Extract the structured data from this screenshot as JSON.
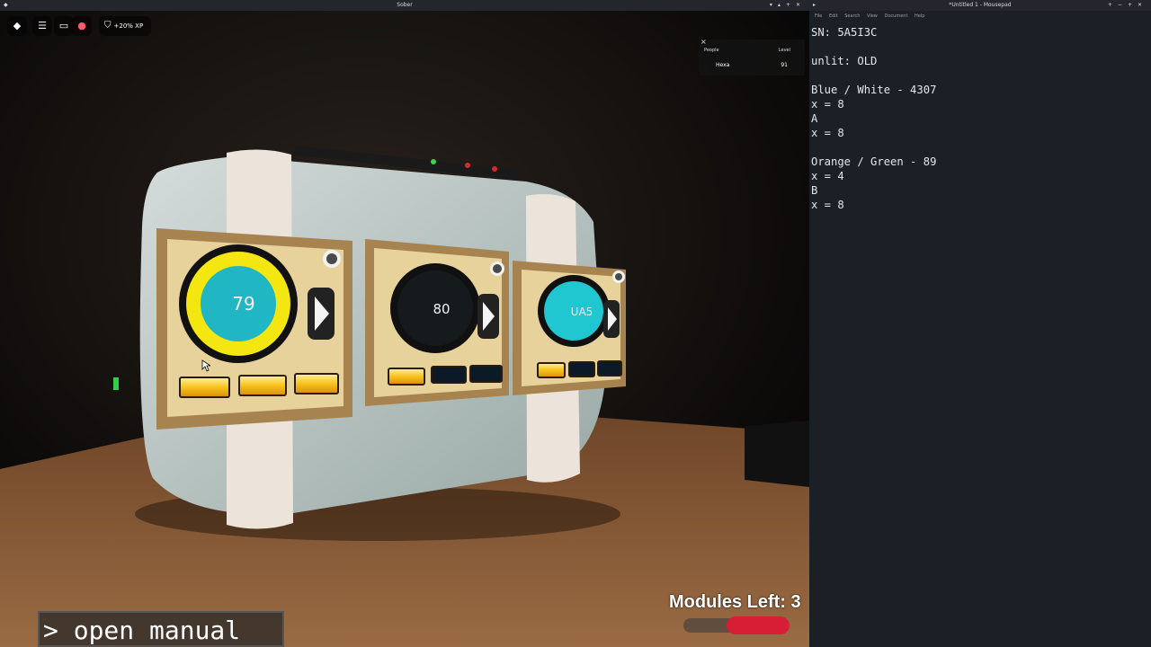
{
  "game_window": {
    "title": "Sober",
    "topbar": {
      "home_icon": "roblox-logo-icon",
      "menu_icon": "hamburger-menu-icon",
      "chat_icon": "chat-icon",
      "mic_icon": "microphone-icon",
      "xp_label": "+20% XP"
    },
    "players_panel": {
      "header_people": "People",
      "header_level": "Level",
      "players": [
        {
          "name": "Hexa",
          "level": "91"
        }
      ]
    },
    "bomb": {
      "modules": [
        {
          "display": "79",
          "ring_color": "#f4e611",
          "face_color": "#20b6c4",
          "lights_on": 3
        },
        {
          "display": "80",
          "ring_color": "#111111",
          "face_color": "#151a1c",
          "lights_on": 1
        },
        {
          "display": "UA5",
          "ring_color": "#111111",
          "face_color": "#20c6d0",
          "lights_on": 1
        }
      ]
    },
    "modules_left_label": "Modules Left: 3",
    "command_prompt": "> open manual"
  },
  "editor_window": {
    "title": "*Untitled 1 - Mousepad",
    "menu": [
      "File",
      "Edit",
      "Search",
      "View",
      "Document",
      "Help"
    ],
    "lines": [
      "SN: 5A5I3C",
      "",
      "unlit: OLD",
      "",
      "Blue / White - 4307",
      "x = 8",
      "A",
      "x = 8",
      "",
      "Orange / Green - 89",
      "x = 4",
      "B",
      "x = 8"
    ]
  },
  "colors": {
    "strike_bar": "#d81e35",
    "module_panel": "#e6d29a",
    "module_frame": "#a7834f",
    "bomb_body": "#b9c6c4",
    "lit_light": "#f7c21c",
    "unlit_light": "#0b1a26"
  }
}
